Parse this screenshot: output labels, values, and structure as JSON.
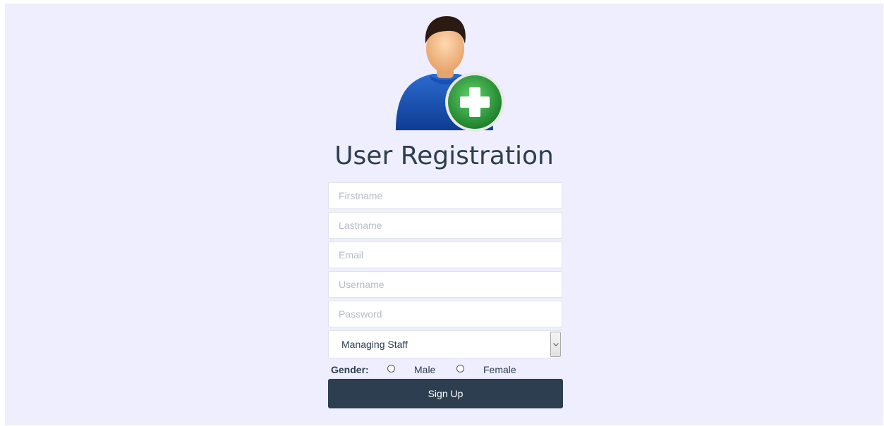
{
  "header": {
    "avatar_icon": "user-add-icon",
    "title": "User Registration"
  },
  "form": {
    "fields": [
      {
        "name": "firstname",
        "placeholder": "Firstname",
        "value": ""
      },
      {
        "name": "lastname",
        "placeholder": "Lastname",
        "value": ""
      },
      {
        "name": "email",
        "placeholder": "Email",
        "value": ""
      },
      {
        "name": "username",
        "placeholder": "Username",
        "value": ""
      },
      {
        "name": "password",
        "placeholder": "Password",
        "value": ""
      }
    ],
    "role_select": {
      "selected": "Managing Staff"
    },
    "gender": {
      "label": "Gender:",
      "options": [
        "Male",
        "Female"
      ],
      "selected": null
    },
    "submit_label": "Sign Up"
  },
  "colors": {
    "background": "#eeeefe",
    "button": "#2c3e50",
    "title": "#2d3e50",
    "plus_green": "#2e9a3c"
  }
}
